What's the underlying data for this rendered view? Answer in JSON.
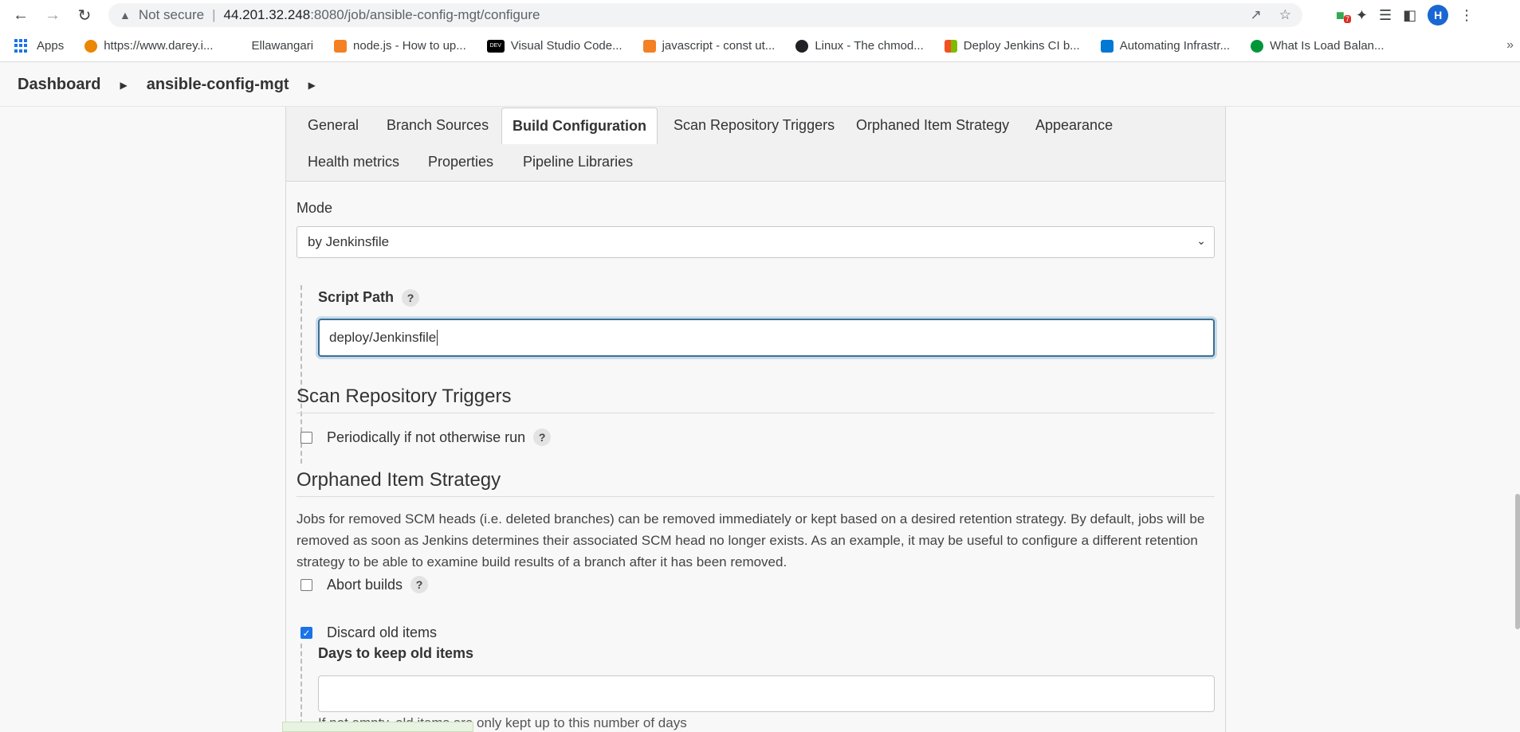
{
  "browser": {
    "not_secure": "Not secure",
    "url_host": "44.201.32.248",
    "url_path": ":8080/job/ansible-config-mgt/configure",
    "profile_initial": "H",
    "ext_badge": "7"
  },
  "bookmarks": [
    {
      "label": "Apps"
    },
    {
      "label": "https://www.darey.i..."
    },
    {
      "label": "Ellawangari"
    },
    {
      "label": "node.js - How to up..."
    },
    {
      "label": "Visual Studio Code..."
    },
    {
      "label": "javascript - const ut..."
    },
    {
      "label": "Linux - The chmod..."
    },
    {
      "label": "Deploy Jenkins CI b..."
    },
    {
      "label": "Automating Infrastr..."
    },
    {
      "label": "What Is Load Balan..."
    }
  ],
  "breadcrumb": {
    "dashboard": "Dashboard",
    "job": "ansible-config-mgt"
  },
  "tabs": [
    {
      "label": "General"
    },
    {
      "label": "Branch Sources"
    },
    {
      "label": "Build Configuration"
    },
    {
      "label": "Scan Repository Triggers"
    },
    {
      "label": "Orphaned Item Strategy"
    },
    {
      "label": "Appearance"
    },
    {
      "label": "Health metrics"
    },
    {
      "label": "Properties"
    },
    {
      "label": "Pipeline Libraries"
    }
  ],
  "build": {
    "mode_label": "Mode",
    "mode_value": "by Jenkinsfile",
    "script_path_label": "Script Path",
    "script_path_value": "deploy/Jenkinsfile"
  },
  "scan": {
    "title": "Scan Repository Triggers",
    "periodic_label": "Periodically if not otherwise run"
  },
  "orphan": {
    "title": "Orphaned Item Strategy",
    "description": "Jobs for removed SCM heads (i.e. deleted branches) can be removed immediately or kept based on a desired retention strategy. By default, jobs will be removed as soon as Jenkins determines their associated SCM head no longer exists. As an example, it may be useful to configure a different retention strategy to be able to examine build results of a branch after it has been removed.",
    "abort_label": "Abort builds",
    "discard_label": "Discard old items",
    "days_label": "Days to keep old items",
    "days_value": "",
    "days_hint": "If not empty, old items are only kept up to this number of days"
  },
  "help_glyph": "?"
}
